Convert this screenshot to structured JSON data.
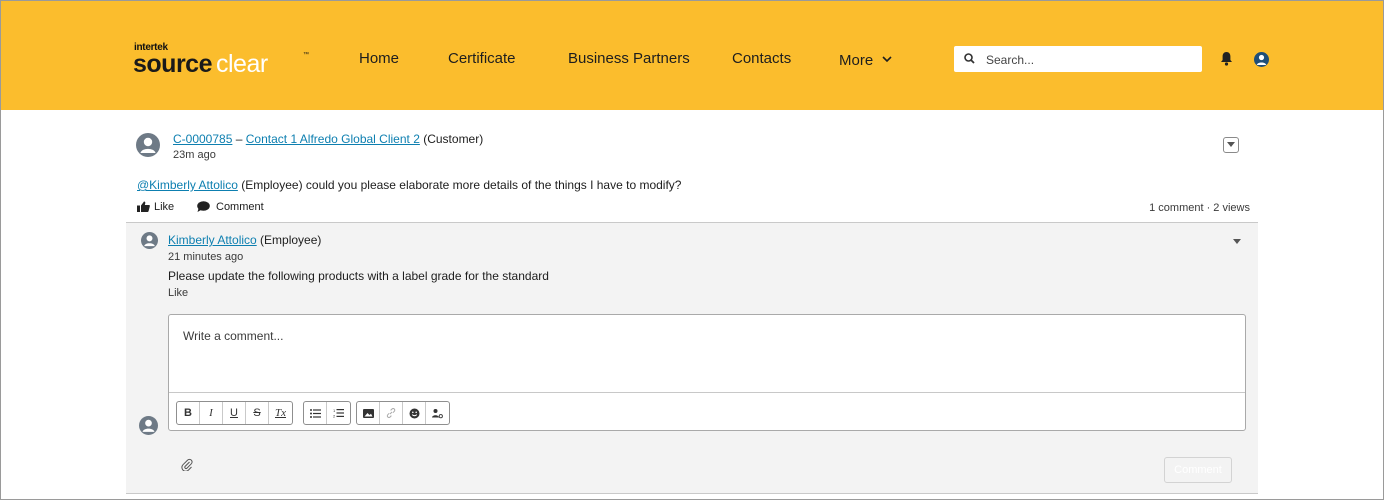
{
  "header": {
    "logo_small": "intertek",
    "logo_source": "source",
    "logo_clear": "clear",
    "nav": [
      {
        "label": "Home"
      },
      {
        "label": "Certificate"
      },
      {
        "label": "Business Partners"
      },
      {
        "label": "Contacts"
      },
      {
        "label": "More"
      }
    ],
    "search_placeholder": "Search..."
  },
  "post": {
    "record_id": "C-0000785",
    "separator": "–",
    "contact": "Contact 1 Alfredo Global Client 2",
    "role": "(Customer)",
    "time": "23m ago",
    "mention": "@Kimberly Attolico",
    "body": " (Employee) could you please elaborate more details of the things I have to modify?",
    "like_label": "Like",
    "comment_label": "Comment",
    "counts": "1 comment · 2 views"
  },
  "comment": {
    "author": "Kimberly Attolico",
    "role": " (Employee)",
    "time": "21 minutes ago",
    "text": "Please update the following products with a label grade for the standard",
    "like": "Like"
  },
  "editor": {
    "placeholder": "Write a comment...",
    "tools": {
      "bold": "B",
      "italic": "I",
      "underline": "U",
      "strike": "S",
      "clear": "Tx"
    },
    "submit_label": "Comment"
  },
  "colors": {
    "header_bg": "#fbbd2d",
    "link": "#0d7fb0",
    "avatar": "#6e7a86"
  }
}
